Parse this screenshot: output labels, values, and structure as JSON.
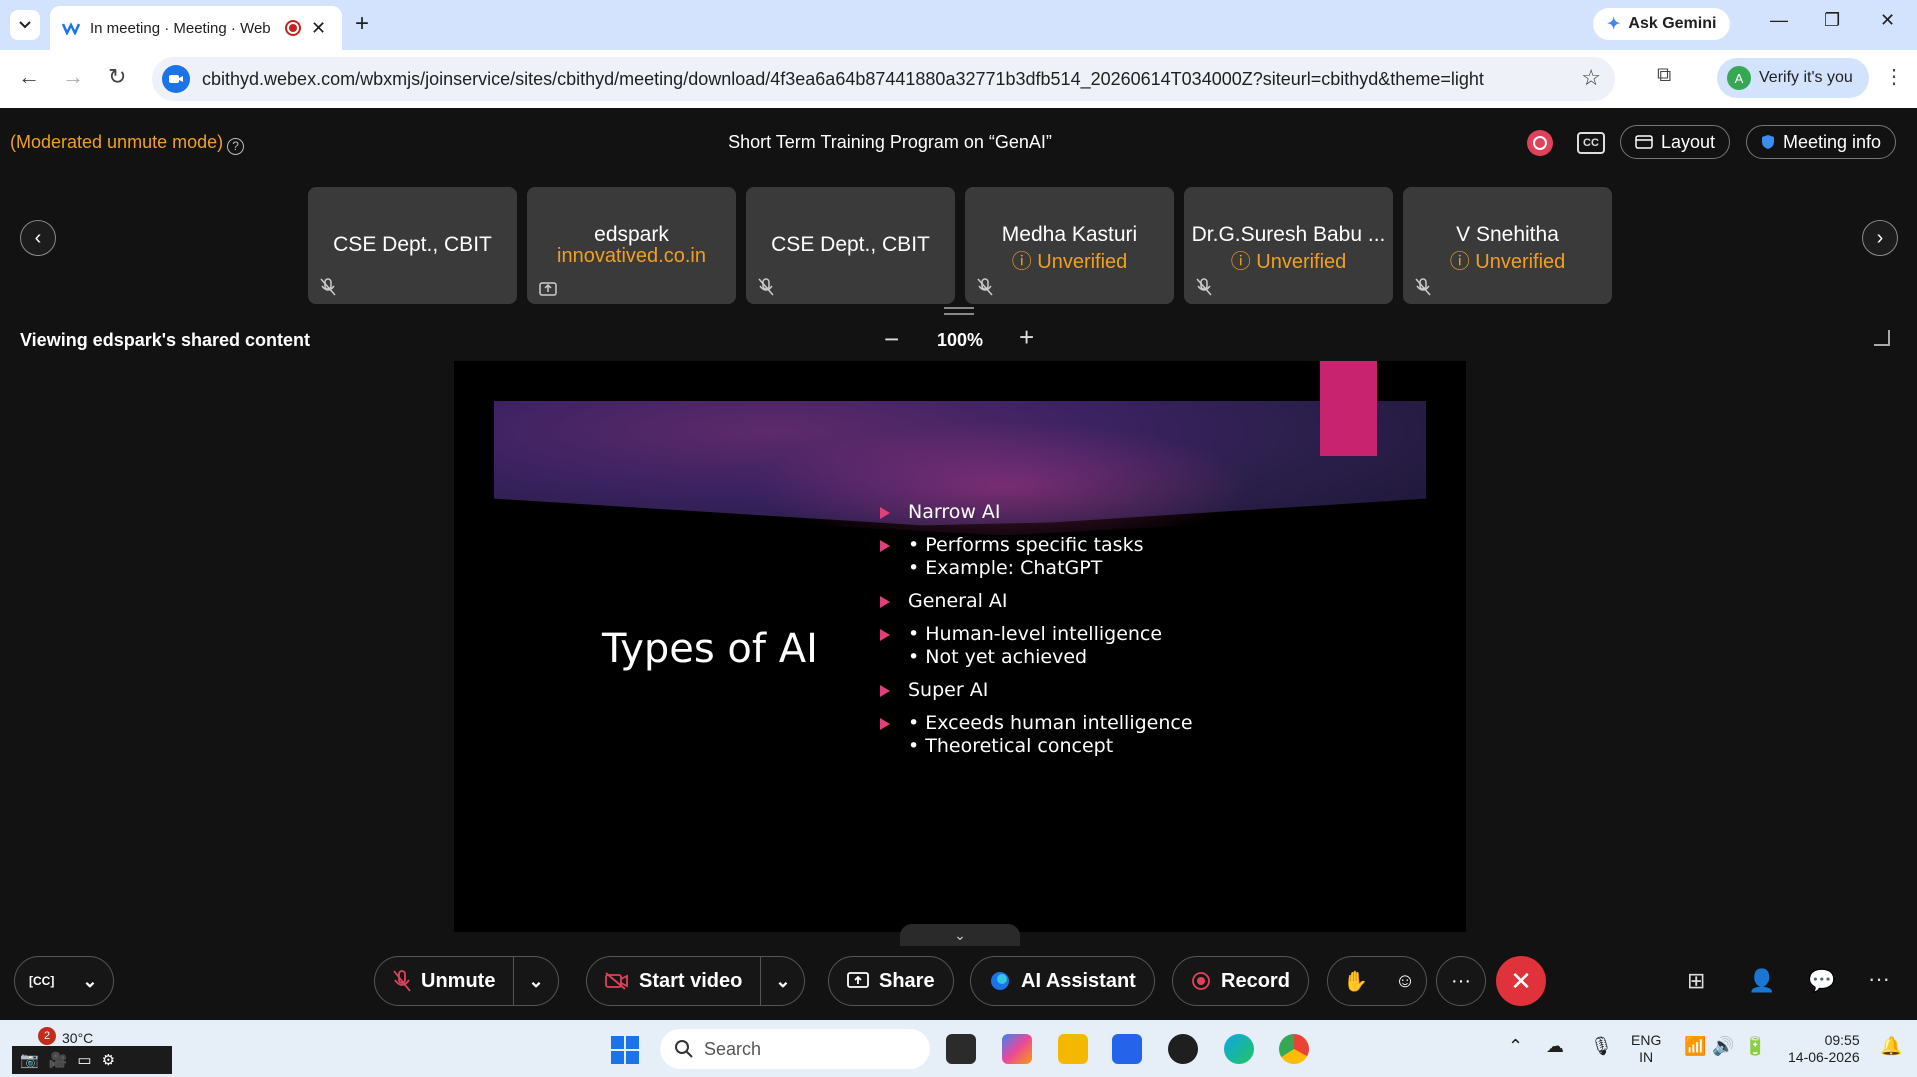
{
  "browser": {
    "tab_title": "In meeting · Meeting · Web",
    "new_tab": "+",
    "ask_gemini": "Ask Gemini",
    "url": "cbithyd.webex.com/wbxmjs/joinservice/sites/cbithyd/meeting/download/4f3ea6a64b87441880a32771b3dfb514_20260614T034000Z?siteurl=cbithyd&theme=light",
    "verify_label": "Verify it's you",
    "verify_avatar": "A"
  },
  "meeting": {
    "moderated_label": "(Moderated unmute mode)",
    "title": "Short Term Training Program on “GenAI”",
    "cc_label": "CC",
    "layout_label": "Layout",
    "meeting_info_label": "Meeting info",
    "participants": [
      {
        "name": "CSE Dept., CBIT",
        "sub": "",
        "icon": "mic-muted-icon"
      },
      {
        "name": "edspark",
        "sub": "innovatived.co.in",
        "icon": "screen-share-icon"
      },
      {
        "name": "CSE Dept., CBIT",
        "sub": "",
        "icon": "mic-muted-icon"
      },
      {
        "name": "Medha Kasturi",
        "sub": "Unverified",
        "icon": "mic-muted-icon"
      },
      {
        "name": "Dr.G.Suresh Babu ...",
        "sub": "Unverified",
        "icon": "mic-muted-icon"
      },
      {
        "name": "V Snehitha",
        "sub": "Unverified",
        "icon": "mic-muted-icon"
      }
    ],
    "share_label": "Viewing edspark's shared content",
    "zoom_level": "100%"
  },
  "slide": {
    "title": "Types of AI",
    "bullets": [
      {
        "main": "Narrow AI"
      },
      {
        "sub": [
          "• Performs specific tasks",
          "• Example: ChatGPT"
        ]
      },
      {
        "main": "General AI"
      },
      {
        "sub": [
          "• Human-level intelligence",
          "• Not yet achieved"
        ]
      },
      {
        "main": "Super AI"
      },
      {
        "sub": [
          "• Exceeds human intelligence",
          "• Theoretical concept"
        ]
      }
    ],
    "accent_color": "#c8236e"
  },
  "controls": {
    "unmute": "Unmute",
    "start_video": "Start video",
    "share": "Share",
    "ai_assistant": "AI Assistant",
    "record": "Record",
    "more": "···"
  },
  "taskbar": {
    "weather_badge": "2",
    "weather_temp": "30°C",
    "search_placeholder": "Search",
    "lang_top": "ENG",
    "lang_bottom": "IN",
    "time": "09:55",
    "date": "14-06-2026"
  },
  "colors": {
    "warning": "#f0a020",
    "end_call": "#e0323a",
    "record": "#e0425b"
  }
}
